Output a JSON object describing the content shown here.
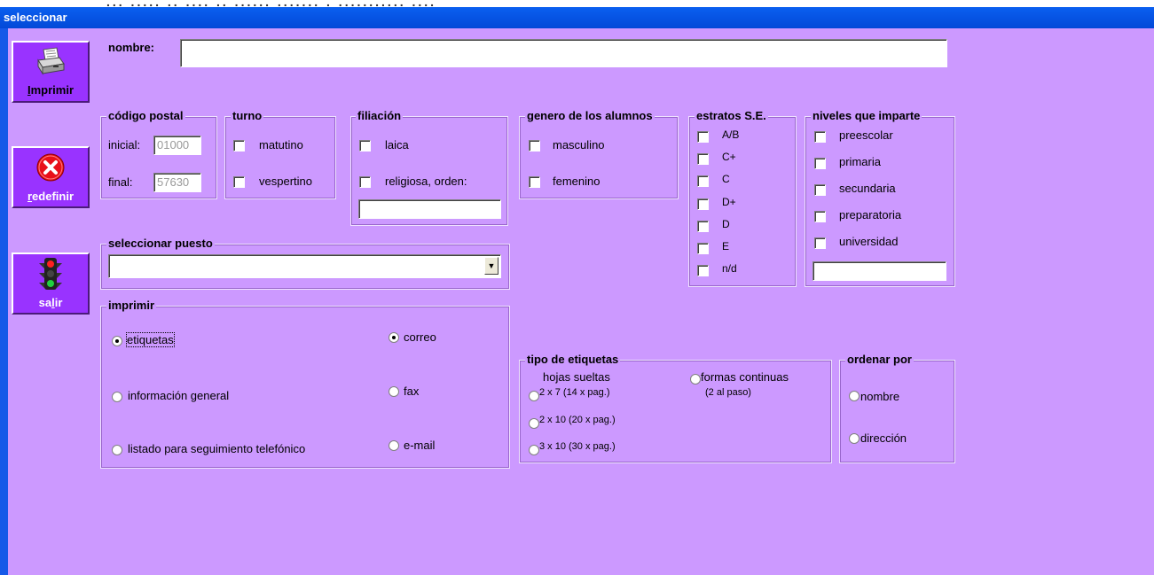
{
  "window": {
    "title": "seleccionar",
    "behind_text": "... ..... .. .... .. ...... ....... . ........... ...."
  },
  "sidebar": {
    "imprimir": {
      "label_u": "I",
      "label_rest": "mprimir"
    },
    "redefinir": {
      "label_u": "r",
      "label_rest": "edefinir"
    },
    "salir": {
      "label_pre": "sa",
      "label_u": "l",
      "label_post": "ir"
    }
  },
  "nombre": {
    "label": "nombre:",
    "value": ""
  },
  "codigo_postal": {
    "title": "código postal",
    "inicial_label": "inicial:",
    "inicial_value": "01000",
    "final_label": "final:",
    "final_value": "57630"
  },
  "turno": {
    "title": "turno",
    "options": [
      "matutino",
      "vespertino"
    ]
  },
  "filiacion": {
    "title": "filiación",
    "options": [
      "laica",
      "religiosa, orden:"
    ],
    "orden_value": ""
  },
  "genero": {
    "title": "genero de los alumnos",
    "options": [
      "masculino",
      "femenino"
    ]
  },
  "estratos": {
    "title": "estratos S.E.",
    "options": [
      "A/B",
      "C+",
      "C",
      "D+",
      "D",
      "E",
      "n/d"
    ]
  },
  "niveles": {
    "title": "niveles que imparte",
    "options": [
      "preescolar",
      "primaria",
      "secundaria",
      "preparatoria",
      "universidad"
    ],
    "other_value": ""
  },
  "puesto": {
    "title": "seleccionar puesto",
    "selected": ""
  },
  "imprimir": {
    "title": "imprimir",
    "tipo_options": [
      "etiquetas",
      "información general",
      "listado para seguimiento telefónico"
    ],
    "tipo_selected": "etiquetas",
    "medio_options": [
      "correo",
      "fax",
      "e-mail"
    ],
    "medio_selected": "correo"
  },
  "tipo_etiquetas": {
    "title": "tipo de etiquetas",
    "hojas_label": "hojas sueltas",
    "hojas_options": [
      "2 x 7  (14 x pag.)",
      "2 x 10 (20 x pag.)",
      "3 x 10 (30 x pag.)"
    ],
    "formas_label": "formas continuas",
    "formas_sub": "(2 al paso)"
  },
  "ordenar": {
    "title": "ordenar por",
    "options": [
      "nombre",
      "dirección"
    ]
  }
}
